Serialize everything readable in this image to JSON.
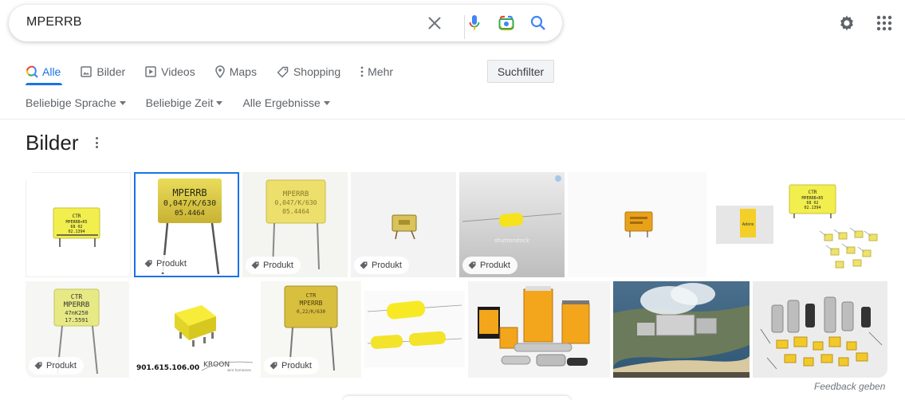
{
  "search": {
    "query": "MPERRB",
    "icons": [
      "close-icon",
      "mic-icon",
      "lens-icon",
      "search-icon"
    ]
  },
  "header_icons": [
    "gear-icon",
    "apps-grid-icon"
  ],
  "tabs": [
    {
      "label": "Alle",
      "icon": "search-multicolor-icon",
      "active": true
    },
    {
      "label": "Bilder",
      "icon": "image-icon"
    },
    {
      "label": "Videos",
      "icon": "play-icon"
    },
    {
      "label": "Maps",
      "icon": "map-pin-icon"
    },
    {
      "label": "Shopping",
      "icon": "tag-icon"
    },
    {
      "label": "Mehr",
      "icon": "more-vert-icon"
    }
  ],
  "suchfilter_label": "Suchfilter",
  "filters": [
    {
      "label": "Beliebige Sprache"
    },
    {
      "label": "Beliebige Zeit"
    },
    {
      "label": "Alle Ergebnisse"
    }
  ],
  "images_section": {
    "title": "Bilder",
    "product_badge": "Produkt"
  },
  "image_texts": {
    "cap1": [
      "CTR",
      "MPERRB+R5",
      "68 02",
      "02.1394"
    ],
    "cap2": [
      "MPERRB",
      "0,047/K/630",
      "05.4464"
    ],
    "cap3": [
      "MPERRB",
      "0,047/K/630",
      "05.4464"
    ],
    "cap9": [
      "CTR",
      "MPERRB",
      "47nK250",
      "17.5591"
    ],
    "cap10_caption": "901.615.106.00",
    "cap10_logo": "KROON",
    "cap10_logo_sub": "wire harnesses",
    "cap11": [
      "CTR",
      "MPERRB",
      "0,22/K/630"
    ],
    "cap7": "Adore",
    "watermark": "shutterstock"
  },
  "feedback_label": "Feedback geben",
  "colors": {
    "accent": "#1a73e8",
    "capacitor_yellow": "#f2e34a",
    "capacitor_orange": "#e8a21a"
  }
}
